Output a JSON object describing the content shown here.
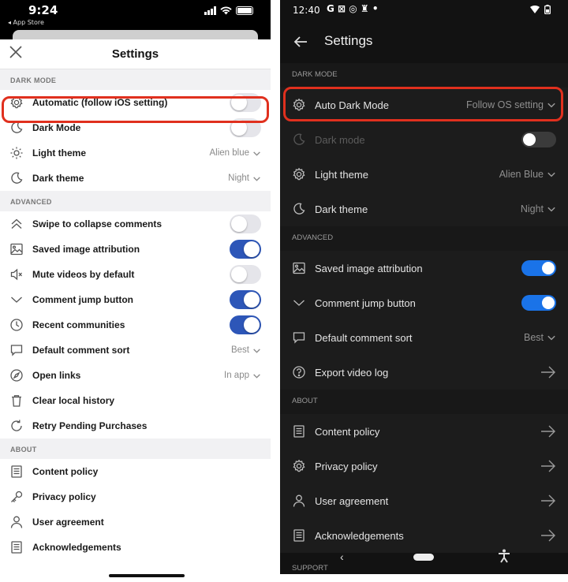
{
  "ios": {
    "status": {
      "time": "9:24",
      "back_label": "◂ App Store"
    },
    "title": "Settings",
    "sections": [
      {
        "header": "DARK MODE",
        "rows": [
          {
            "icon": "gear-icon",
            "label": "Automatic (follow iOS setting)",
            "control": "toggle",
            "on": false,
            "highlighted": true
          },
          {
            "icon": "moon-icon",
            "label": "Dark Mode",
            "control": "toggle",
            "on": false
          },
          {
            "icon": "sun-icon",
            "label": "Light theme",
            "control": "select",
            "value": "Alien blue"
          },
          {
            "icon": "moon-icon",
            "label": "Dark theme",
            "control": "select",
            "value": "Night"
          }
        ]
      },
      {
        "header": "ADVANCED",
        "rows": [
          {
            "icon": "double-chevron-up-icon",
            "label": "Swipe to collapse comments",
            "control": "toggle",
            "on": false
          },
          {
            "icon": "image-icon",
            "label": "Saved image attribution",
            "control": "toggle",
            "on": true
          },
          {
            "icon": "speaker-mute-icon",
            "label": "Mute videos by default",
            "control": "toggle",
            "on": false
          },
          {
            "icon": "chevron-down-icon",
            "label": "Comment jump button",
            "control": "toggle",
            "on": true
          },
          {
            "icon": "clock-icon",
            "label": "Recent communities",
            "control": "toggle",
            "on": true
          },
          {
            "icon": "comment-icon",
            "label": "Default comment sort",
            "control": "select",
            "value": "Best"
          },
          {
            "icon": "compass-icon",
            "label": "Open links",
            "control": "select",
            "value": "In app"
          },
          {
            "icon": "trash-icon",
            "label": "Clear local history",
            "control": "none"
          },
          {
            "icon": "refresh-icon",
            "label": "Retry Pending Purchases",
            "control": "none"
          }
        ]
      },
      {
        "header": "ABOUT",
        "rows": [
          {
            "icon": "document-icon",
            "label": "Content policy",
            "control": "none"
          },
          {
            "icon": "key-icon",
            "label": "Privacy policy",
            "control": "none"
          },
          {
            "icon": "person-icon",
            "label": "User agreement",
            "control": "none"
          },
          {
            "icon": "document-icon",
            "label": "Acknowledgements",
            "control": "none"
          }
        ]
      }
    ]
  },
  "android": {
    "status": {
      "time": "12:40",
      "icons": "G ⊠ ◎ ♜ •"
    },
    "title": "Settings",
    "sections": [
      {
        "header": "DARK MODE",
        "rows": [
          {
            "icon": "gear-icon",
            "label": "Auto Dark Mode",
            "control": "select",
            "value": "Follow OS setting",
            "highlighted": true
          },
          {
            "icon": "moon-icon",
            "label": "Dark mode",
            "control": "toggle",
            "on": false,
            "disabled": true
          },
          {
            "icon": "gear-icon",
            "label": "Light theme",
            "control": "select",
            "value": "Alien Blue"
          },
          {
            "icon": "moon-icon",
            "label": "Dark theme",
            "control": "select",
            "value": "Night"
          }
        ]
      },
      {
        "header": "ADVANCED",
        "rows": [
          {
            "icon": "image-icon",
            "label": "Saved image attribution",
            "control": "toggle",
            "on": true
          },
          {
            "icon": "chevron-down-icon",
            "label": "Comment jump button",
            "control": "toggle",
            "on": true
          },
          {
            "icon": "comment-icon",
            "label": "Default comment sort",
            "control": "select",
            "value": "Best"
          },
          {
            "icon": "question-icon",
            "label": "Export video log",
            "control": "arrow"
          }
        ]
      },
      {
        "header": "ABOUT",
        "rows": [
          {
            "icon": "document-icon",
            "label": "Content policy",
            "control": "arrow"
          },
          {
            "icon": "gear-icon",
            "label": "Privacy policy",
            "control": "arrow"
          },
          {
            "icon": "person-icon",
            "label": "User agreement",
            "control": "arrow"
          },
          {
            "icon": "document-icon",
            "label": "Acknowledgements",
            "control": "arrow"
          }
        ]
      }
    ],
    "support_header": "SUPPORT"
  },
  "colors": {
    "ios_toggle_on": "#2d56b8",
    "android_toggle_on": "#1a73e8",
    "highlight": "#e0301e"
  }
}
